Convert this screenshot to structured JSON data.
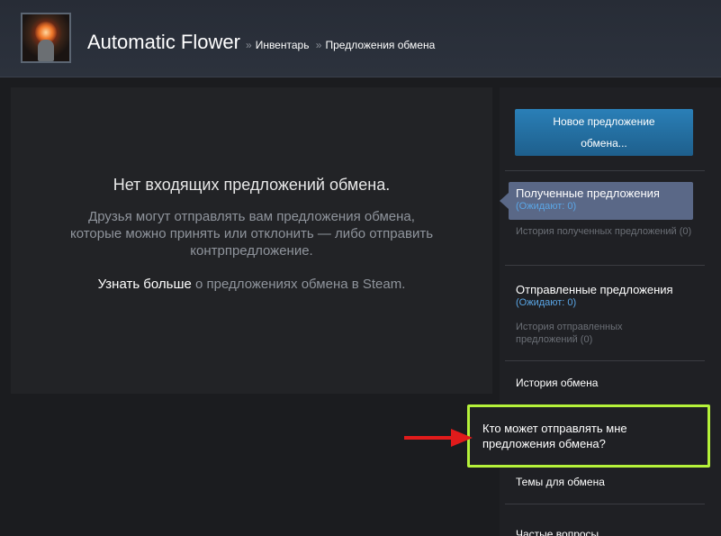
{
  "header": {
    "profile_name": "Automatic Flower",
    "breadcrumb_sep": "»",
    "breadcrumbs": [
      "Инвентарь",
      "Предложения обмена"
    ]
  },
  "main": {
    "empty_title": "Нет входящих предложений обмена.",
    "empty_desc": "Друзья могут отправлять вам предложения обмена, которые можно принять или отклонить — либо отправить контрпредложение.",
    "learn_more_link": "Узнать больше",
    "learn_more_rest": " о предложениях обмена в Steam."
  },
  "sidebar": {
    "new_offer_line1": "Новое предложение",
    "new_offer_line2": "обмена...",
    "received_title": "Полученные предложения",
    "received_pending": "(Ожидают: 0)",
    "received_history": "История полученных предложений (0)",
    "sent_title": "Отправленные предложения",
    "sent_pending": "(Ожидают: 0)",
    "sent_history": "История отправленных предложений (0)",
    "trade_history": "История обмена",
    "who_can_send": "Кто может отправлять мне предложения обмена?",
    "trade_topics": "Темы для обмена",
    "faq": "Частые вопросы"
  },
  "colors": {
    "accent_highlight": "#b5f23a",
    "arrow": "#e11b1b",
    "button": "#2a7fb7",
    "active_nav": "#5a6887",
    "pending_link": "#5aa6e6"
  },
  "icons": {
    "arrow": "red-arrow-icon",
    "avatar": "avatar"
  }
}
